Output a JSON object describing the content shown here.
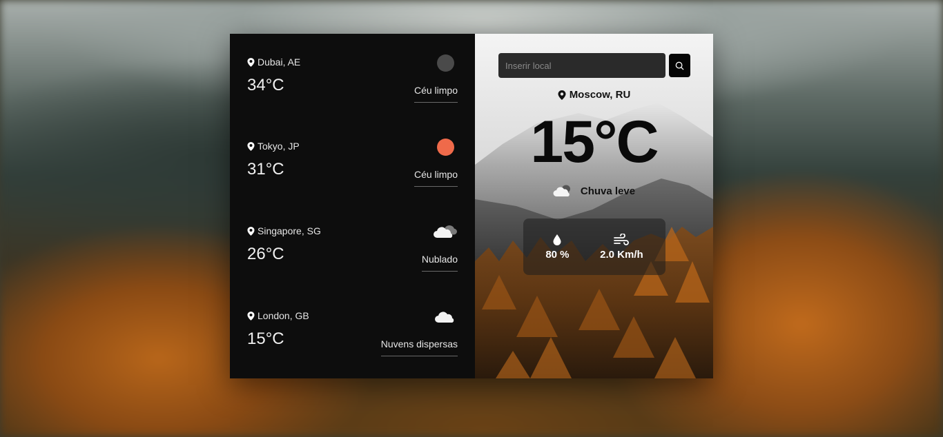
{
  "cities": [
    {
      "name": "Dubai, AE",
      "temp": "34°C",
      "desc": "Céu limpo",
      "icon": "clear-sky-dark-dot",
      "color": "#4a4a4a"
    },
    {
      "name": "Tokyo, JP",
      "temp": "31°C",
      "desc": "Céu limpo",
      "icon": "clear-sky-orange-dot",
      "color": "#ef6a4a"
    },
    {
      "name": "Singapore, SG",
      "temp": "26°C",
      "desc": "Nublado",
      "icon": "cloudy-icon"
    },
    {
      "name": "London, GB",
      "temp": "15°C",
      "desc": "Nuvens dispersas",
      "icon": "scattered-clouds-icon"
    }
  ],
  "search": {
    "placeholder": "Inserir local",
    "button_icon": "search-icon"
  },
  "current": {
    "location": "Moscow, RU",
    "temp": "15°C",
    "condition": "Chuva leve",
    "condition_icon": "light-rain-cloud-icon",
    "humidity": "80 %",
    "humidity_icon": "droplet-icon",
    "wind": "2.0 Km/h",
    "wind_icon": "wind-icon"
  }
}
